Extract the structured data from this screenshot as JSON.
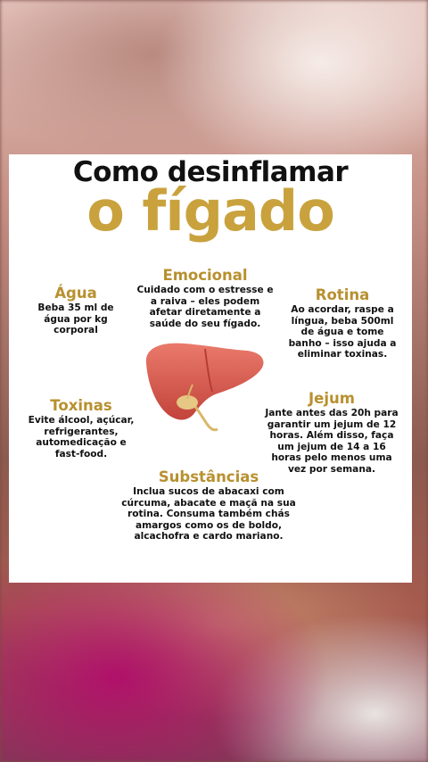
{
  "title_line1": "Como desinflamar",
  "title_line2": "o fígado",
  "sections": {
    "agua": {
      "heading": "Água",
      "text": "Beba 35 ml de água por kg corporal"
    },
    "emocional": {
      "heading": "Emocional",
      "text": "Cuidado com o estresse e a raiva – eles podem afetar diretamente a saúde do seu fígado."
    },
    "rotina": {
      "heading": "Rotina",
      "text": "Ao acordar, raspe a língua, beba 500ml de água e tome banho – isso ajuda a eliminar toxinas."
    },
    "toxinas": {
      "heading": "Toxinas",
      "text": "Evite álcool, açúcar, refrigerantes, automedicação e fast-food."
    },
    "jejum": {
      "heading": "Jejum",
      "text": "Jante antes das 20h para garantir um jejum de 12 horas. Além disso, faça um jejum de 14 a 16 horas pelo menos uma vez por semana."
    },
    "substancias": {
      "heading": "Substâncias",
      "text": "Inclua sucos de abacaxi com cúrcuma, abacate e maçã na sua rotina. Consuma também chás amargos como os de boldo, alcachofra e cardo mariano."
    }
  },
  "colors": {
    "gold": "#c9a23e",
    "liver": "#d9574a"
  },
  "icons": {
    "illustration": "liver-illustration"
  }
}
